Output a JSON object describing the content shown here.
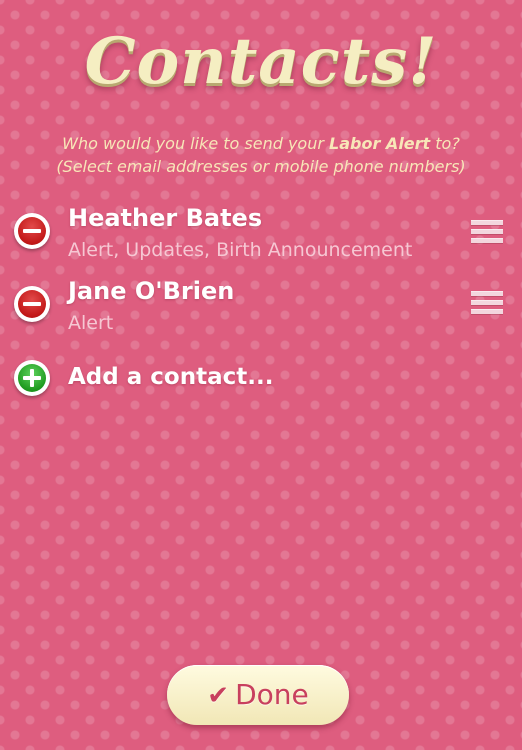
{
  "header": {
    "title": "Contacts!",
    "subtitle_line1_prefix": "Who would you like to send your",
    "subtitle_highlight": "Labor Alert",
    "subtitle_line1_suffix": "to?",
    "subtitle_line2": "(Select email addresses or mobile phone numbers)"
  },
  "contacts": [
    {
      "name": "Heather Bates",
      "detail": "Alert, Updates, Birth Announcement",
      "remove_icon": "minus-circle-icon",
      "reorder_icon": "reorder-grip-icon"
    },
    {
      "name": "Jane O'Brien",
      "detail": "Alert",
      "remove_icon": "minus-circle-icon",
      "reorder_icon": "reorder-grip-icon"
    }
  ],
  "add_contact": {
    "label": "Add a contact...",
    "icon": "plus-circle-icon"
  },
  "done_button": {
    "label": "Done",
    "icon": "checkmark-icon"
  },
  "colors": {
    "background": "#de5d7f",
    "title": "#f5eec2",
    "remove_red": "#c21818",
    "add_green": "#1f9a1f",
    "button_text": "#c8405e"
  }
}
